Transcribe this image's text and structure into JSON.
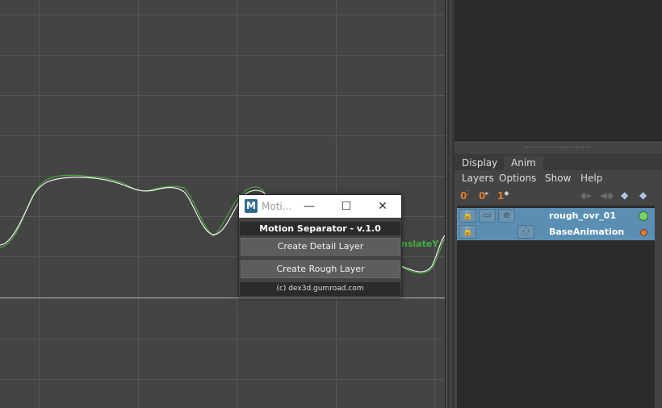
{
  "graph_editor": {
    "curve_label": "nslateY"
  },
  "layer_editor": {
    "tabs": [
      "Display",
      "Anim"
    ],
    "active_tab": "Anim",
    "menu": [
      "Layers",
      "Options",
      "Show",
      "Help"
    ],
    "toolbar": {
      "icon1": "0",
      "icon2": "0",
      "icon3": "1"
    },
    "layers": [
      {
        "name": "rough_ovr_01",
        "status_color": "#7ad16a"
      },
      {
        "name": "BaseAnimation",
        "status_color": "#e07a3a"
      }
    ]
  },
  "dialog": {
    "window_title": "Moti...",
    "logo_letter": "M",
    "header": "Motion Separator  -  v.1.0",
    "buttons": {
      "create_detail": "Create Detail Layer",
      "create_rough": "Create Rough Layer"
    },
    "footer": "(c) dex3d.gumroad.com",
    "window_controls": {
      "minimize": "—",
      "maximize": "☐",
      "close": "✕"
    }
  }
}
